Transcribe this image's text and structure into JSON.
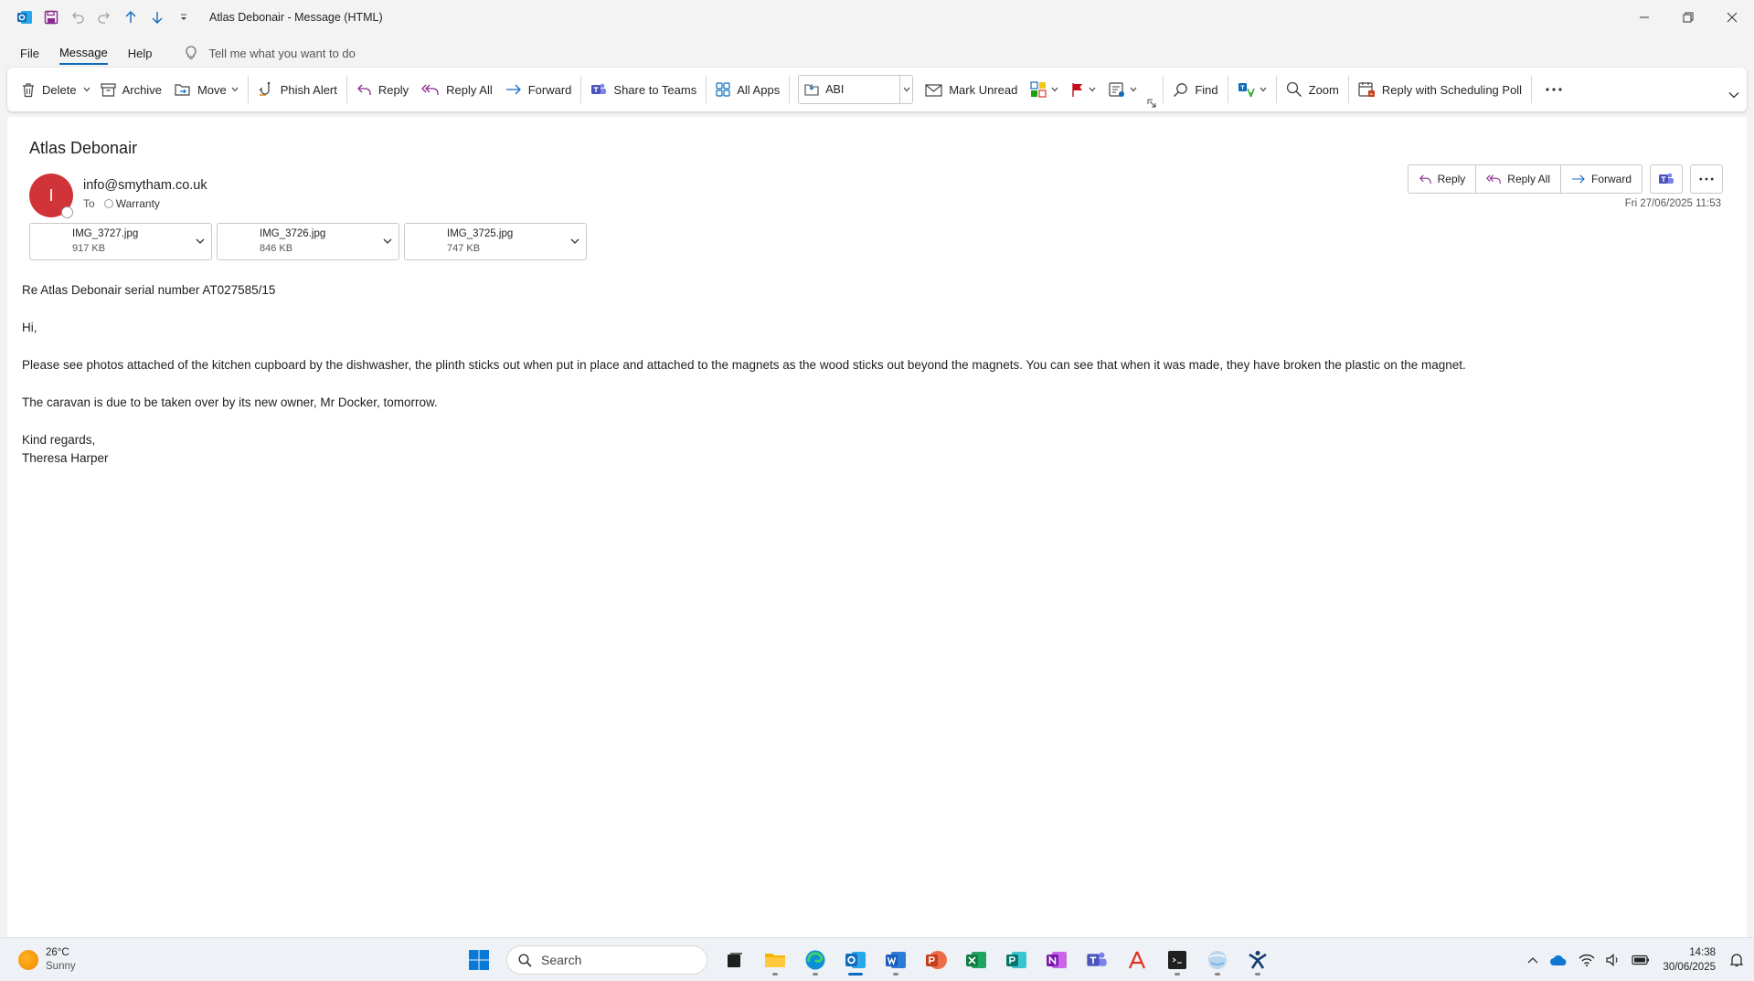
{
  "window": {
    "title": "Atlas Debonair  -  Message (HTML)"
  },
  "menu": {
    "items": [
      "File",
      "Message",
      "Help"
    ],
    "tell_me": "Tell me what you want to do"
  },
  "ribbon": {
    "delete": "Delete",
    "archive": "Archive",
    "move": "Move",
    "phish_alert": "Phish Alert",
    "reply": "Reply",
    "reply_all": "Reply All",
    "forward": "Forward",
    "share_teams": "Share to Teams",
    "all_apps": "All Apps",
    "quick_step": "ABI",
    "mark_unread": "Mark Unread",
    "find": "Find",
    "zoom": "Zoom",
    "scheduling_poll": "Reply with Scheduling Poll"
  },
  "message": {
    "subject": "Atlas Debonair",
    "avatar_initial": "I",
    "sender": "info@smytham.co.uk",
    "to_label": "To",
    "recipient": "Warranty",
    "date": "Fri 27/06/2025 11:53",
    "actions": {
      "reply": "Reply",
      "reply_all": "Reply All",
      "forward": "Forward"
    },
    "attachments": [
      {
        "name": "IMG_3727.jpg",
        "size": "917 KB"
      },
      {
        "name": "IMG_3726.jpg",
        "size": "846 KB"
      },
      {
        "name": "IMG_3725.jpg",
        "size": "747 KB"
      }
    ],
    "body": {
      "line1": "Re Atlas Debonair serial number AT027585/15",
      "greeting": "Hi,",
      "para1": "Please see photos attached of the kitchen cupboard by the dishwasher, the plinth sticks out when put in place and attached to the magnets as the wood sticks out beyond the magnets. You can see that when it was made, they have broken the plastic on the magnet.",
      "para2": "The caravan is due to be taken over by its new owner, Mr Docker, tomorrow.",
      "signoff": "Kind regards,",
      "signature": "Theresa Harper"
    }
  },
  "taskbar": {
    "weather_temp": "26°C",
    "weather_cond": "Sunny",
    "search": "Search",
    "time": "14:38",
    "date": "30/06/2025"
  },
  "colors": {
    "accent": "#0f6cbd",
    "avatar": "#d13438",
    "flag": "#c50f1f"
  }
}
